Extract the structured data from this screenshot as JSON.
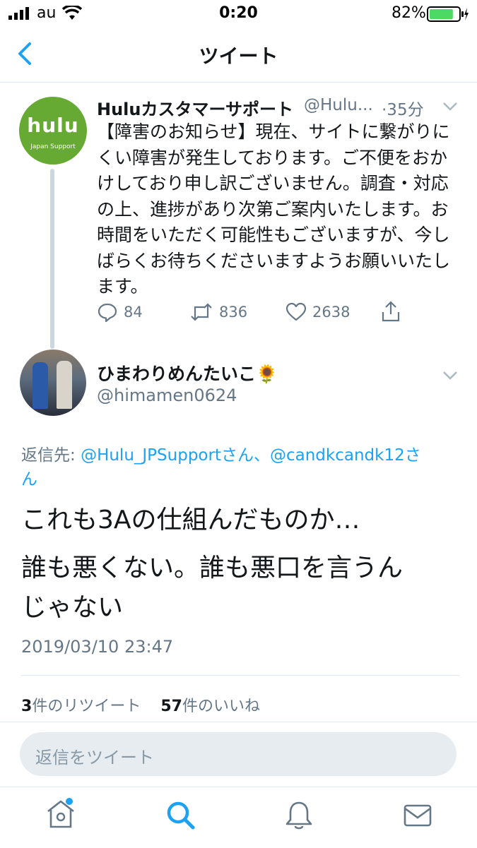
{
  "status_bar": {
    "carrier": "au",
    "time": "0:20",
    "battery": "82%",
    "battery_level": 0.82
  },
  "header": {
    "title": "ツイート"
  },
  "parent_tweet": {
    "avatar_text": "hulu",
    "avatar_subtext": "Japan Support",
    "display_name": "Huluカスタマーサポート",
    "handle": "@Hulu...",
    "time": "·35分",
    "text_lines": [
      "【障害のお知らせ】現在、サイトに繋がりに",
      "くい障害が発生しております。ご不便をおか",
      "けしており申し訳ございません。調査・対応",
      "の上、進捗があり次第ご案内いたします。お",
      "時間をいただく可能性もございますが、今し",
      "ばらくお待ちくださいますようお願いいたし",
      "ます。"
    ],
    "replies": "84",
    "retweets": "836",
    "likes": "2638"
  },
  "main_tweet": {
    "display_name": "ひまわりめんたいこ🌻",
    "handle": "@himamen0624",
    "reply_to_label": "返信先:",
    "reply_to_1": "@Hulu_JPSupportさん",
    "reply_sep": "、",
    "reply_to_2": "@candkcandk12さ",
    "reply_to_2b": "ん",
    "text_lines": [
      "これも3Aの仕組んだものか…",
      "誰も悪くない。誰も悪口を言うん",
      "じゃない"
    ],
    "timestamp": "2019/03/10 23:47",
    "retweet_count": "3",
    "retweet_label": "件のリツイート",
    "like_count": "57",
    "like_label": "件のいいね"
  },
  "reply_box": {
    "placeholder": "返信をツイート"
  },
  "tab_bar": {
    "items": [
      "home",
      "search",
      "notifications",
      "messages"
    ],
    "active": "search"
  },
  "colors": {
    "accent": "#1da1f2",
    "hulu_green": "#66aa33",
    "battery_green": "#4cd964"
  }
}
